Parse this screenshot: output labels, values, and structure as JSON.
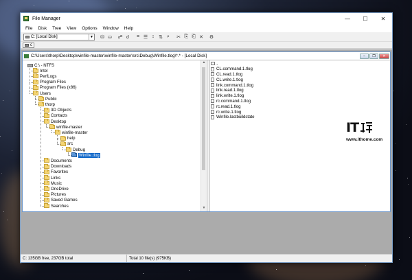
{
  "window": {
    "title": "File Manager",
    "controls": {
      "minimize": "—",
      "maximize": "☐",
      "close": "✕"
    }
  },
  "menu": [
    "File",
    "Disk",
    "Tree",
    "View",
    "Options",
    "Window",
    "Help"
  ],
  "toolbar": {
    "drive_select": "C: [Local Disk]"
  },
  "drives": [
    {
      "label": "c"
    }
  ],
  "child_window": {
    "title": "C:\\Users\\thorp\\Desktop\\winfile-master\\winfile-master\\src\\Debug\\Winfile.tlog\\*.* - [Local Disk]"
  },
  "tree": {
    "root": "C:\\ - NTFS",
    "nodes": [
      {
        "label": "Intel",
        "depth": 1
      },
      {
        "label": "PerfLogs",
        "depth": 1
      },
      {
        "label": "Program Files",
        "depth": 1
      },
      {
        "label": "Program Files (x86)",
        "depth": 1
      },
      {
        "label": "Users",
        "depth": 1
      },
      {
        "label": "Public",
        "depth": 2
      },
      {
        "label": "thorp",
        "depth": 2
      },
      {
        "label": "3D Objects",
        "depth": 3
      },
      {
        "label": "Contacts",
        "depth": 3
      },
      {
        "label": "Desktop",
        "depth": 3
      },
      {
        "label": "winfile-master",
        "depth": 4
      },
      {
        "label": "winfile-master",
        "depth": 5
      },
      {
        "label": "help",
        "depth": 6
      },
      {
        "label": "src",
        "depth": 6
      },
      {
        "label": "Debug",
        "depth": 7
      },
      {
        "label": "Winfile.tlog",
        "depth": 8,
        "selected": true
      },
      {
        "label": "Documents",
        "depth": 3
      },
      {
        "label": "Downloads",
        "depth": 3
      },
      {
        "label": "Favorites",
        "depth": 3
      },
      {
        "label": "Links",
        "depth": 3
      },
      {
        "label": "Music",
        "depth": 3
      },
      {
        "label": "OneDrive",
        "depth": 3
      },
      {
        "label": "Pictures",
        "depth": 3
      },
      {
        "label": "Saved Games",
        "depth": 3
      },
      {
        "label": "Searches",
        "depth": 3
      }
    ]
  },
  "files": {
    "updir": "..",
    "items": [
      "CL.command.1.tlog",
      "CL.read.1.tlog",
      "CL.write.1.tlog",
      "link.command.1.tlog",
      "link.read.1.tlog",
      "link.write.1.tlog",
      "rc.command.1.tlog",
      "rc.read.1.tlog",
      "rc.write.1.tlog",
      "Winfile.lastbuildstate"
    ]
  },
  "status": {
    "left": "C: 135GB free,  237GB total",
    "right": "Total 10 file(s) (975KB)"
  },
  "watermark": {
    "logo_text": "IT",
    "url": "www.ithome.com"
  },
  "colors": {
    "selection": "#0a64c8",
    "folder": "#f4d472",
    "mdi_background": "#ababab"
  }
}
